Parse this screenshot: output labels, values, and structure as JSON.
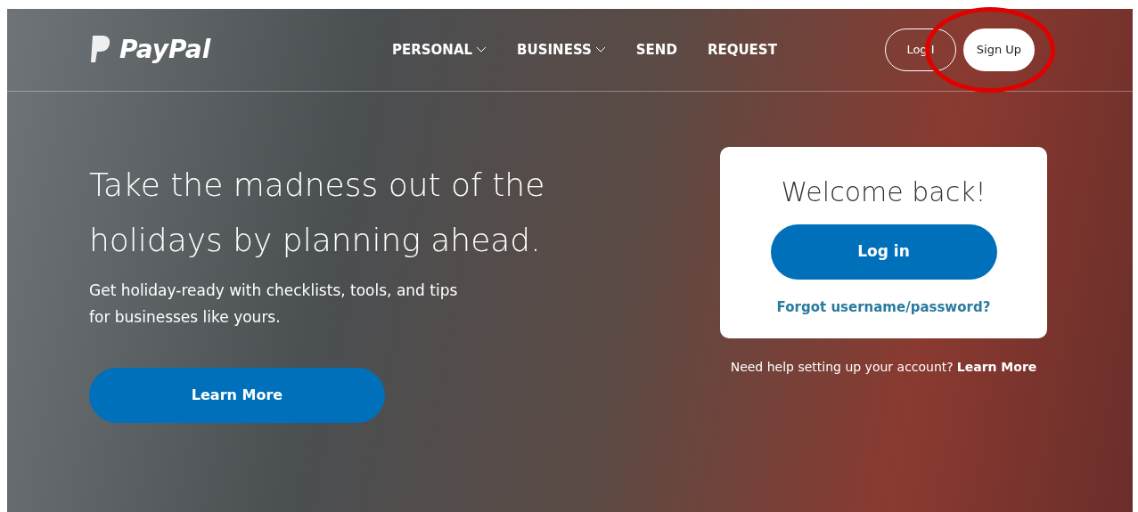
{
  "header": {
    "logo": "PayPal",
    "nav": [
      {
        "label": "PERSONAL",
        "dropdown": true
      },
      {
        "label": "BUSINESS",
        "dropdown": true
      },
      {
        "label": "SEND",
        "dropdown": false
      },
      {
        "label": "REQUEST",
        "dropdown": false
      }
    ],
    "login_button": "Log I",
    "signup_button": "Sign Up"
  },
  "hero": {
    "heading": "Take the madness out of the holidays by planning ahead.",
    "subtext": "Get holiday-ready with checklists, tools, and tips for businesses like yours.",
    "button": "Learn More"
  },
  "login_card": {
    "title": "Welcome back!",
    "button": "Log in",
    "forgot_link": "Forgot username/password?"
  },
  "help": {
    "text": "Need help setting up your account?",
    "link": "Learn More"
  }
}
